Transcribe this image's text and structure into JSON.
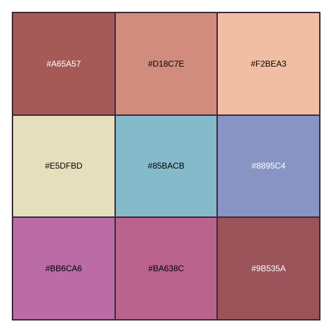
{
  "palette": {
    "swatches": [
      {
        "label": "#A65A57",
        "color": "#A65A57",
        "text_color": "#ffffff"
      },
      {
        "label": "#D18C7E",
        "color": "#D18C7E",
        "text_color": "#000000"
      },
      {
        "label": "#F2BEA3",
        "color": "#F2BEA3",
        "text_color": "#000000"
      },
      {
        "label": "#E5DFBD",
        "color": "#E5DFBD",
        "text_color": "#000000"
      },
      {
        "label": "#85BACB",
        "color": "#85BACB",
        "text_color": "#000000"
      },
      {
        "label": "#8895C4",
        "color": "#8895C4",
        "text_color": "#ffffff"
      },
      {
        "label": "#BB6CA6",
        "color": "#BB6CA6",
        "text_color": "#000000"
      },
      {
        "label": "#BA638C",
        "color": "#BA638C",
        "text_color": "#000000"
      },
      {
        "label": "#9B535A",
        "color": "#9B535A",
        "text_color": "#ffffff"
      }
    ]
  }
}
